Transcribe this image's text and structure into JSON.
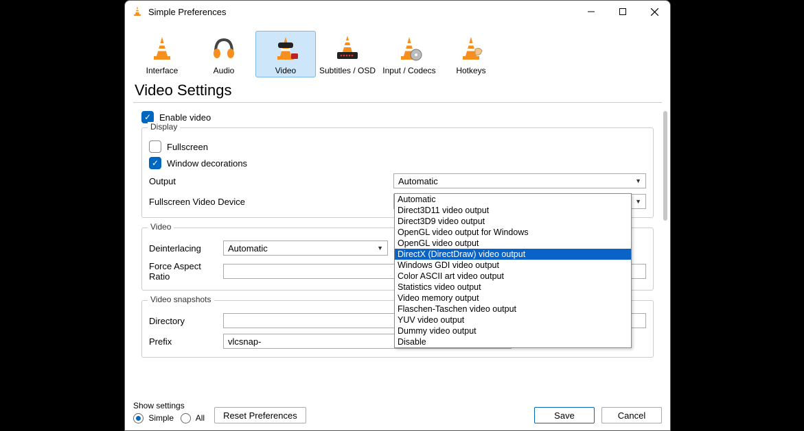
{
  "window": {
    "title": "Simple Preferences"
  },
  "toolbar": {
    "items": [
      {
        "label": "Interface"
      },
      {
        "label": "Audio"
      },
      {
        "label": "Video"
      },
      {
        "label": "Subtitles / OSD"
      },
      {
        "label": "Input / Codecs"
      },
      {
        "label": "Hotkeys"
      }
    ]
  },
  "heading": "Video Settings",
  "enable_video_label": "Enable video",
  "groups": {
    "display": {
      "title": "Display",
      "fullscreen_label": "Fullscreen",
      "window_decorations_label": "Window decorations",
      "output_label": "Output",
      "output_value": "Automatic",
      "fullscreen_device_label": "Fullscreen Video Device"
    },
    "video": {
      "title": "Video",
      "deinterlacing_label": "Deinterlacing",
      "deinterlacing_value": "Automatic",
      "force_aspect_label": "Force Aspect Ratio"
    },
    "snapshots": {
      "title": "Video snapshots",
      "directory_label": "Directory",
      "prefix_label": "Prefix",
      "prefix_value": "vlcsnap-"
    }
  },
  "output_dropdown": {
    "items": [
      "Automatic",
      "Direct3D11 video output",
      "Direct3D9 video output",
      "OpenGL video output for Windows",
      "OpenGL video output",
      "DirectX (DirectDraw) video output",
      "Windows GDI video output",
      "Color ASCII art video output",
      "Statistics video output",
      "Video memory output",
      "Flaschen-Taschen video output",
      "YUV video output",
      "Dummy video output",
      "Disable"
    ],
    "highlighted_index": 5
  },
  "footer": {
    "show_settings_label": "Show settings",
    "simple_label": "Simple",
    "all_label": "All",
    "reset_label": "Reset Preferences",
    "save_label": "Save",
    "cancel_label": "Cancel"
  }
}
